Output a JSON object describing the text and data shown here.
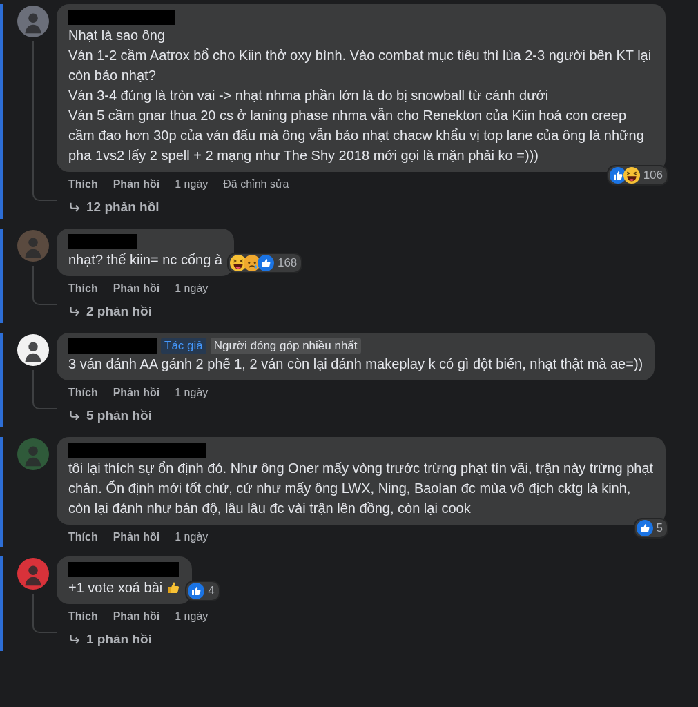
{
  "comments": [
    {
      "paragraphs": [
        "Nhạt là sao ông",
        "Ván 1-2 cầm Aatrox bổ cho Kiin thở oxy bình. Vào combat mục tiêu thì lùa 2-3 người bên KT lại còn bảo nhạt?",
        "Ván 3-4 đúng là tròn vai -> nhạt nhma phần lớn là do bị snowball từ cánh dưới",
        "Ván 5 cầm gnar thua 20 cs ở laning phase nhma vẫn cho Renekton của Kiin hoá con creep cầm đao hơn 30p của ván đấu mà ông vẫn bảo nhạt chacw khẩu vị top lane của ông là những pha 1vs2 lấy 2 spell + 2 mạng như The Shy 2018 mới gọi là mặn phải ko =)))"
      ],
      "reactions": {
        "icons": [
          {
            "kind": "like"
          },
          {
            "kind": "haha"
          }
        ],
        "count": "106"
      },
      "actions": {
        "like": "Thích",
        "reply": "Phản hồi",
        "time": "1 ngày",
        "edited": "Đã chỉnh sửa"
      },
      "replies": "12 phản hồi"
    },
    {
      "paragraphs": [
        "nhạt? thế kiin= nc cống à"
      ],
      "reactions": {
        "icons": [
          {
            "kind": "haha"
          },
          {
            "kind": "sad"
          },
          {
            "kind": "like"
          }
        ],
        "count": "168"
      },
      "actions": {
        "like": "Thích",
        "reply": "Phản hồi",
        "time": "1 ngày"
      },
      "replies": "2 phản hồi"
    },
    {
      "badges": [
        {
          "kind": "author",
          "label": "Tác giả"
        },
        {
          "kind": "top_contributor",
          "label": "Người đóng góp nhiều nhất"
        }
      ],
      "paragraphs": [
        "3 ván đánh AA gánh 2 phế 1, 2 ván còn lại đánh makeplay k có gì đột biến, nhạt thật mà ae=))"
      ],
      "actions": {
        "like": "Thích",
        "reply": "Phản hồi",
        "time": "1 ngày"
      },
      "replies": "5 phản hồi"
    },
    {
      "paragraphs": [
        "tôi lại thích sự ổn định đó. Như ông Oner mấy vòng trước trừng phạt tín vãi, trận này trừng phạt chán. Ổn định mới tốt chứ, cứ như mấy ông LWX, Ning, Baolan đc mùa vô địch cktg là kinh, còn lại đánh như bán độ, lâu lâu đc vài trận lên đồng, còn lại cook"
      ],
      "reactions": {
        "icons": [
          {
            "kind": "like"
          }
        ],
        "count": "5"
      },
      "actions": {
        "like": "Thích",
        "reply": "Phản hồi",
        "time": "1 ngày"
      }
    },
    {
      "paragraphs": [
        "+1 vote xoá bài"
      ],
      "trailing_icon": {
        "kind": "thumbs_up"
      },
      "reactions": {
        "icons": [
          {
            "kind": "like"
          }
        ],
        "count": "4"
      },
      "actions": {
        "like": "Thích",
        "reply": "Phản hồi",
        "time": "1 ngày"
      },
      "replies": "1 phản hồi"
    }
  ]
}
